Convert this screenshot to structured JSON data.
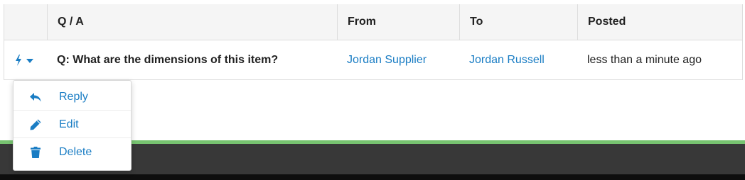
{
  "table": {
    "headers": {
      "qa": "Q / A",
      "from": "From",
      "to": "To",
      "posted": "Posted"
    },
    "rows": [
      {
        "question": "Q: What are the dimensions of this item?",
        "from": "Jordan Supplier",
        "to": "Jordan Russell",
        "posted": "less than a minute ago"
      }
    ]
  },
  "actions_menu": {
    "trigger_icon": "lightning-bolt-icon",
    "items": [
      {
        "label": "Reply",
        "icon": "reply-icon"
      },
      {
        "label": "Edit",
        "icon": "pencil-icon"
      },
      {
        "label": "Delete",
        "icon": "trash-icon"
      }
    ]
  },
  "colors": {
    "link": "#1a7dc4",
    "header_bg": "#f5f5f5",
    "footer": "#383838",
    "footer_accent": "#77c370"
  }
}
